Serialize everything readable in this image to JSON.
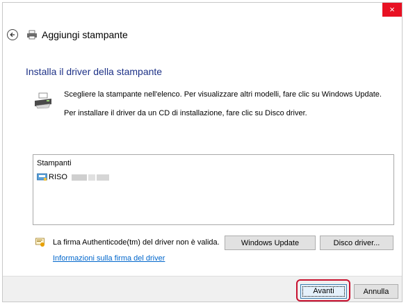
{
  "window": {
    "title": "Aggiungi stampante",
    "close_label": "×"
  },
  "main": {
    "heading": "Installa il driver della stampante",
    "instruction_1": "Scegliere la stampante nell'elenco. Per visualizzare altri modelli, fare clic su Windows Update.",
    "instruction_2": "Per installare il driver da un CD di installazione, fare clic su Disco driver."
  },
  "printer_list": {
    "column_header": "Stampanti",
    "items": [
      {
        "label": "RISO"
      }
    ]
  },
  "signature": {
    "warning_text": "La firma Authenticode(tm) del driver non è valida.",
    "link_text": "Informazioni sulla firma del driver"
  },
  "buttons": {
    "windows_update": "Windows Update",
    "disk_driver": "Disco driver...",
    "next": "Avanti",
    "cancel": "Annulla"
  },
  "colors": {
    "heading": "#1e3287",
    "link": "#0066cc",
    "close_bg": "#e81123",
    "highlight": "#c8102e"
  }
}
